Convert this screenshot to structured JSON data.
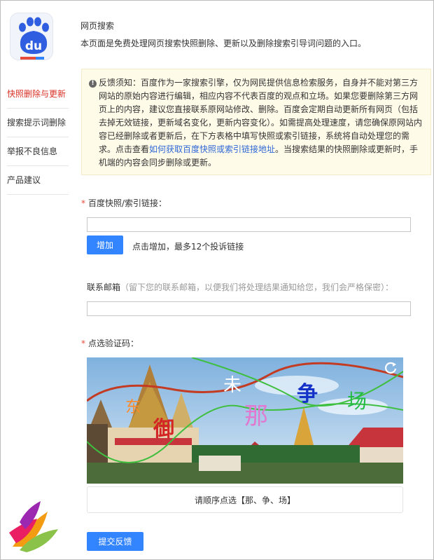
{
  "logo": {
    "text": "du"
  },
  "header": {
    "title": "网页搜索",
    "desc": "本页面是免费处理网页搜索快照删除、更新以及删除搜索引导词问题的入口。"
  },
  "sidebar": {
    "items": [
      {
        "label": "快照删除与更新",
        "active": true
      },
      {
        "label": "搜索提示词删除",
        "active": false
      },
      {
        "label": "举报不良信息",
        "active": false
      },
      {
        "label": "产品建议",
        "active": false
      }
    ]
  },
  "notice": {
    "text_before": "反馈须知：百度作为一家搜索引擎，仅为网民提供信息检索服务，自身并不能对第三方网站的原始内容进行编辑，相应内容不代表百度的观点和立场。如果您要删除第三方网页上的内容，建议您直接联系原网站修改、删除。百度会定期自动更新所有网页（包括去掉无效链接，更新域名变化，更新内容变化）。如需提高处理速度，请您确保原网站内容已经删除或者更新后，在下方表格中填写快照或索引链接，系统将自动处理您的需求。点击查看",
    "link_text": "如何获取百度快照或索引链接地址",
    "text_after": "。当搜索结果的快照删除或更新时，手机端的内容会同步删除或更新。"
  },
  "form": {
    "required_mark": "*",
    "link_label": "百度快照/索引链接：",
    "link_value": "",
    "add_button": "增加",
    "add_hint": "点击增加，最多12个投诉链接",
    "email_label": "联系邮箱",
    "email_hint": "（留下您的联系邮箱，以便我们将处理结果通知给您，我们会严格保密）：",
    "email_value": "",
    "captcha_label": "点选验证码：",
    "captcha_prompt": "请顺序点选【那、争、场】",
    "submit_button": "提交反馈"
  },
  "captcha_chars": {
    "c1": "未",
    "c2": "那",
    "c3": "争",
    "c4": "场",
    "c5": "御",
    "c6": "东"
  },
  "colors": {
    "accent": "#3385ff",
    "active_nav": "#d93025",
    "required": "#e74c3c",
    "notice_bg": "#fffbe9",
    "link": "#2d67d6"
  },
  "icons": {
    "notice": "exclamation-circle-icon",
    "refresh": "refresh-icon",
    "logo": "baidu-paw-logo",
    "watermark": "colorful-bird-logo"
  }
}
